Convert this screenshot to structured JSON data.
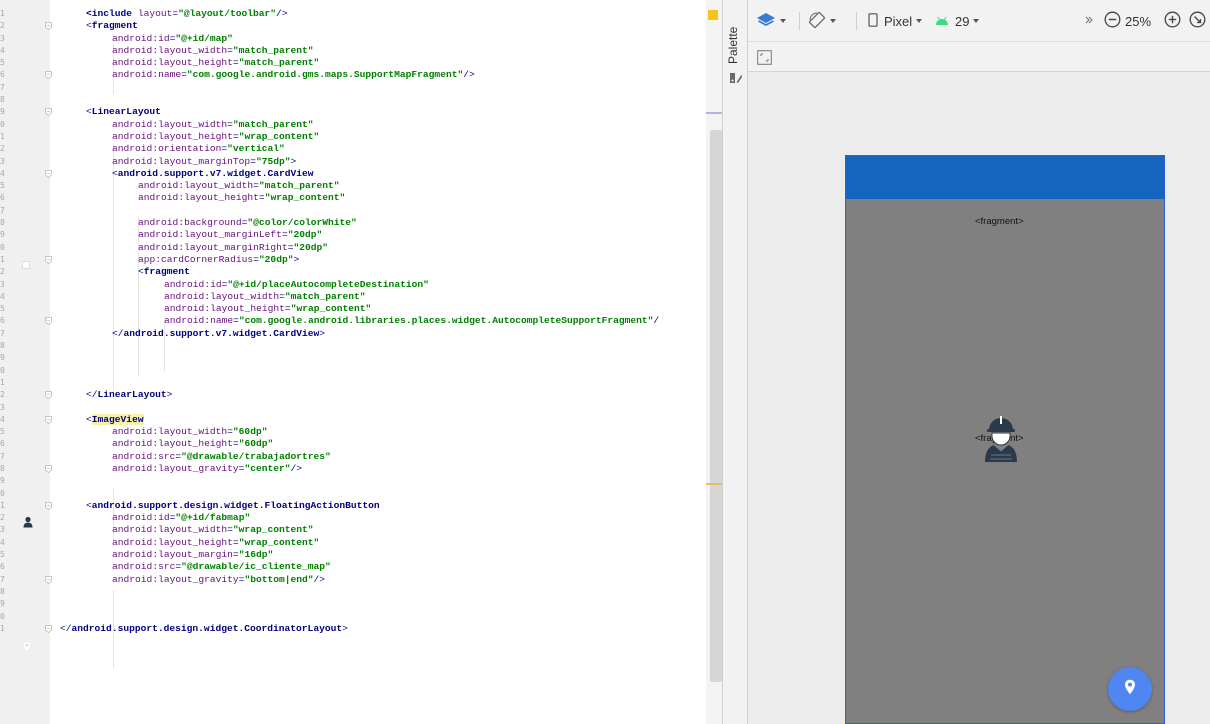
{
  "editor": {
    "line_numbers": [
      "1",
      "2",
      "3",
      "4",
      "5",
      "6",
      "7",
      "8",
      "9",
      "0",
      "1",
      "2",
      "3",
      "4",
      "5",
      "6",
      "7",
      "8",
      "9",
      "0",
      "1",
      "2",
      "3",
      "4",
      "5",
      "6",
      "7",
      "8",
      "9",
      "0",
      "1",
      "2",
      "3",
      "4",
      "5",
      "6",
      "7",
      "8",
      "9",
      "0",
      "1",
      "2",
      "3",
      "4",
      "5",
      "6",
      "7",
      "8",
      "9",
      "0",
      "1",
      "2",
      "3",
      "4",
      "5",
      "6",
      "7",
      "8",
      "9",
      "0"
    ],
    "lines": [
      {
        "indent": 1,
        "text": "<include layout=\"@layout/toolbar\"/>"
      },
      {
        "indent": 1,
        "text": "<fragment"
      },
      {
        "indent": 2,
        "text": "android:id=\"@+id/map\""
      },
      {
        "indent": 2,
        "text": "android:layout_width=\"match_parent\""
      },
      {
        "indent": 2,
        "text": "android:layout_height=\"match_parent\""
      },
      {
        "indent": 2,
        "text": "android:name=\"com.google.android.gms.maps.SupportMapFragment\"/>"
      },
      {
        "indent": 0,
        "text": ""
      },
      {
        "indent": 0,
        "text": ""
      },
      {
        "indent": 1,
        "text": "<LinearLayout"
      },
      {
        "indent": 2,
        "text": "android:layout_width=\"match_parent\""
      },
      {
        "indent": 2,
        "text": "android:layout_height=\"wrap_content\""
      },
      {
        "indent": 2,
        "text": "android:orientation=\"vertical\""
      },
      {
        "indent": 2,
        "text": "android:layout_marginTop=\"75dp\">"
      },
      {
        "indent": 2,
        "text": "<android.support.v7.widget.CardView"
      },
      {
        "indent": 3,
        "text": "android:layout_width=\"match_parent\""
      },
      {
        "indent": 3,
        "text": "android:layout_height=\"wrap_content\""
      },
      {
        "indent": 0,
        "text": ""
      },
      {
        "indent": 3,
        "text": "android:background=\"@color/colorWhite\""
      },
      {
        "indent": 3,
        "text": "android:layout_marginLeft=\"20dp\""
      },
      {
        "indent": 3,
        "text": "android:layout_marginRight=\"20dp\""
      },
      {
        "indent": 3,
        "text": "app:cardCornerRadius=\"20dp\">"
      },
      {
        "indent": 3,
        "text": "<fragment"
      },
      {
        "indent": 4,
        "text": "android:id=\"@+id/placeAutocompleteDestination\""
      },
      {
        "indent": 4,
        "text": "android:layout_width=\"match_parent\""
      },
      {
        "indent": 4,
        "text": "android:layout_height=\"wrap_content\""
      },
      {
        "indent": 4,
        "text": "android:name=\"com.google.android.libraries.places.widget.AutocompleteSupportFragment\"/"
      },
      {
        "indent": 2,
        "text": "</android.support.v7.widget.CardView>"
      },
      {
        "indent": 0,
        "text": ""
      },
      {
        "indent": 0,
        "text": ""
      },
      {
        "indent": 0,
        "text": ""
      },
      {
        "indent": 0,
        "text": ""
      },
      {
        "indent": 1,
        "text": "</LinearLayout>"
      },
      {
        "indent": 0,
        "text": ""
      },
      {
        "indent": 1,
        "text": "<ImageView"
      },
      {
        "indent": 2,
        "text": "android:layout_width=\"60dp\""
      },
      {
        "indent": 2,
        "text": "android:layout_height=\"60dp\""
      },
      {
        "indent": 2,
        "text": "android:src=\"@drawable/trabajadortres\""
      },
      {
        "indent": 2,
        "text": "android:layout_gravity=\"center\"/>"
      },
      {
        "indent": 0,
        "text": ""
      },
      {
        "indent": 0,
        "text": ""
      },
      {
        "indent": 1,
        "text": "<android.support.design.widget.FloatingActionButton"
      },
      {
        "indent": 2,
        "text": "android:id=\"@+id/fabmap\""
      },
      {
        "indent": 2,
        "text": "android:layout_width=\"wrap_content\""
      },
      {
        "indent": 2,
        "text": "android:layout_height=\"wrap_content\""
      },
      {
        "indent": 2,
        "text": "android:layout_margin=\"16dp\""
      },
      {
        "indent": 2,
        "text": "android:src=\"@drawable/ic_cliente_map\""
      },
      {
        "indent": 2,
        "text": "android:layout_gravity=\"bottom|end\"/>"
      },
      {
        "indent": 0,
        "text": ""
      },
      {
        "indent": 0,
        "text": ""
      },
      {
        "indent": 0,
        "text": ""
      },
      {
        "indent": 0,
        "text": "</android.support.design.widget.CoordinatorLayout>"
      }
    ],
    "fold_lines": [
      1,
      5,
      8,
      13,
      20,
      25,
      31,
      33,
      37,
      40,
      46,
      50
    ],
    "highlighted_tag_line": 33,
    "highlighted_tag": "ImageView"
  },
  "palette": {
    "label": "Palette",
    "icon": "palette-icon"
  },
  "design_toolbar": {
    "layers_icon": "layers-icon",
    "orientation_icon": "rotate-icon",
    "device_label": "Pixel",
    "device_icon": "phone-icon",
    "api_label": "29",
    "api_icon": "android-icon",
    "overflow_icon": "double-chevron-icon",
    "zoom_level": "25%",
    "zoom_out_icon": "zoom-out-icon",
    "zoom_in_icon": "zoom-in-icon",
    "fit_icon": "zoom-fit-icon",
    "frame_icon": "frame-icon"
  },
  "preview": {
    "appbar_color": "#1565c0",
    "body_color": "#808080",
    "fragment_top_label": "<fragment>",
    "fragment_center_label": "<fragment>",
    "image_icon": "worker-icon",
    "fab_icon": "location-pin-icon",
    "fab_color": "#4f86f2"
  }
}
